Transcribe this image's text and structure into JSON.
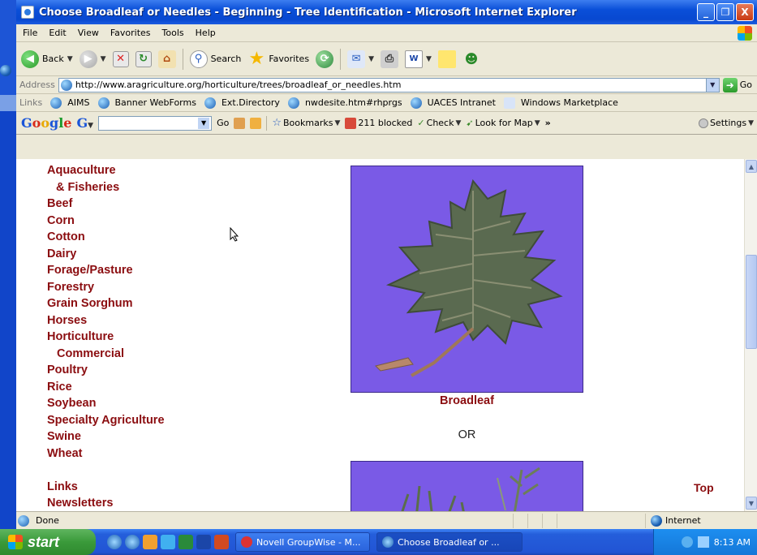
{
  "window": {
    "title": "Choose Broadleaf or Needles - Beginning - Tree Identification - Microsoft Internet Explorer",
    "minimize": "_",
    "maximize": "❐",
    "close": "X"
  },
  "menu": [
    "File",
    "Edit",
    "View",
    "Favorites",
    "Tools",
    "Help"
  ],
  "toolbar": {
    "back_label": "Back",
    "search_label": "Search",
    "favorites_label": "Favorites"
  },
  "address": {
    "label": "Address",
    "url": "http://www.aragriculture.org/horticulture/trees/broadleaf_or_needles.htm",
    "go_label": "Go"
  },
  "links": {
    "label": "Links",
    "items": [
      "AIMS",
      "Banner WebForms",
      "Ext.Directory",
      "nwdesite.htm#rhprgs",
      "UACES Intranet",
      "Windows Marketplace"
    ]
  },
  "googlebar": {
    "logo": "Google",
    "go_label": "Go",
    "bookmarks_label": "Bookmarks",
    "blocked_label": "211 blocked",
    "check_label": "Check",
    "lookfor_label": "Look for Map",
    "more_label": "»",
    "settings_label": "Settings"
  },
  "nav": {
    "items": [
      "Aquaculture",
      "& Fisheries",
      "Beef",
      "Corn",
      "Cotton",
      "Dairy",
      "Forage/Pasture",
      "Forestry",
      "Grain Sorghum",
      "Horses",
      "Horticulture",
      "Commercial",
      "Poultry",
      "Rice",
      "Soybean",
      "Specialty Agriculture",
      "Swine",
      "Wheat"
    ],
    "links_label": "Links",
    "newsletters_label": "Newsletters"
  },
  "main": {
    "broadleaf_caption": "Broadleaf",
    "or_text": "OR",
    "top_link": "Top"
  },
  "status": {
    "text": "Done",
    "zone": "Internet"
  },
  "taskbar": {
    "start_label": "start",
    "tasks": [
      "Novell GroupWise - M...",
      "Choose Broadleaf or ..."
    ],
    "clock": "8:13 AM"
  },
  "colors": {
    "nav_link": "#8b0d10",
    "photo_background": "#7a5ae6",
    "xp_blue": "#0a4fd8"
  }
}
